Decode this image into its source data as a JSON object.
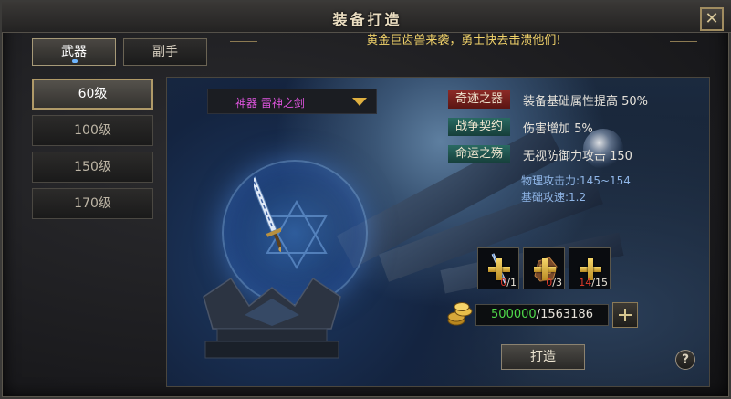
{
  "window": {
    "title": "装备打造",
    "close_icon": "close-icon"
  },
  "tabs": [
    {
      "label": "武器",
      "active": true
    },
    {
      "label": "副手",
      "active": false
    }
  ],
  "notice": "黄金巨齿兽来袭，勇士快去击溃他们!",
  "levels": [
    {
      "label": "60级",
      "active": true
    },
    {
      "label": "100级",
      "active": false
    },
    {
      "label": "150级",
      "active": false
    },
    {
      "label": "170级",
      "active": false
    }
  ],
  "weapon_select": {
    "value": "神器 雷神之剑",
    "icon": "chevron-down-icon",
    "text_color": "#e055e0"
  },
  "attributes": [
    {
      "tag": "奇迹之器",
      "tag_color": "#8c2a26",
      "text": "装备基础属性提高 50%"
    },
    {
      "tag": "战争契约",
      "tag_color": "#2a6a62",
      "text": "伤害增加 5%"
    },
    {
      "tag": "命运之殇",
      "tag_color": "#2a6a62",
      "text": "无视防御力攻击 150"
    }
  ],
  "stats": [
    {
      "text": "物理攻击力:145~154"
    },
    {
      "text": "基础攻速:1.2"
    }
  ],
  "materials": [
    {
      "icon": "sword-material-icon",
      "have": "0",
      "need": "/1"
    },
    {
      "icon": "ore-material-icon",
      "have": "0",
      "need": "/3"
    },
    {
      "icon": "gem-material-icon",
      "have": "14",
      "need": "/15"
    }
  ],
  "gold": {
    "icon": "gold-coins-icon",
    "have": "500000",
    "separator": "/",
    "need": "1563186"
  },
  "buttons": {
    "forge": "打造",
    "help": "?",
    "add_gold_icon": "plus-icon"
  },
  "colors": {
    "accent_gold": "#e0b040",
    "insufficient": "#e03a2a",
    "sufficient": "#4fd84a"
  }
}
